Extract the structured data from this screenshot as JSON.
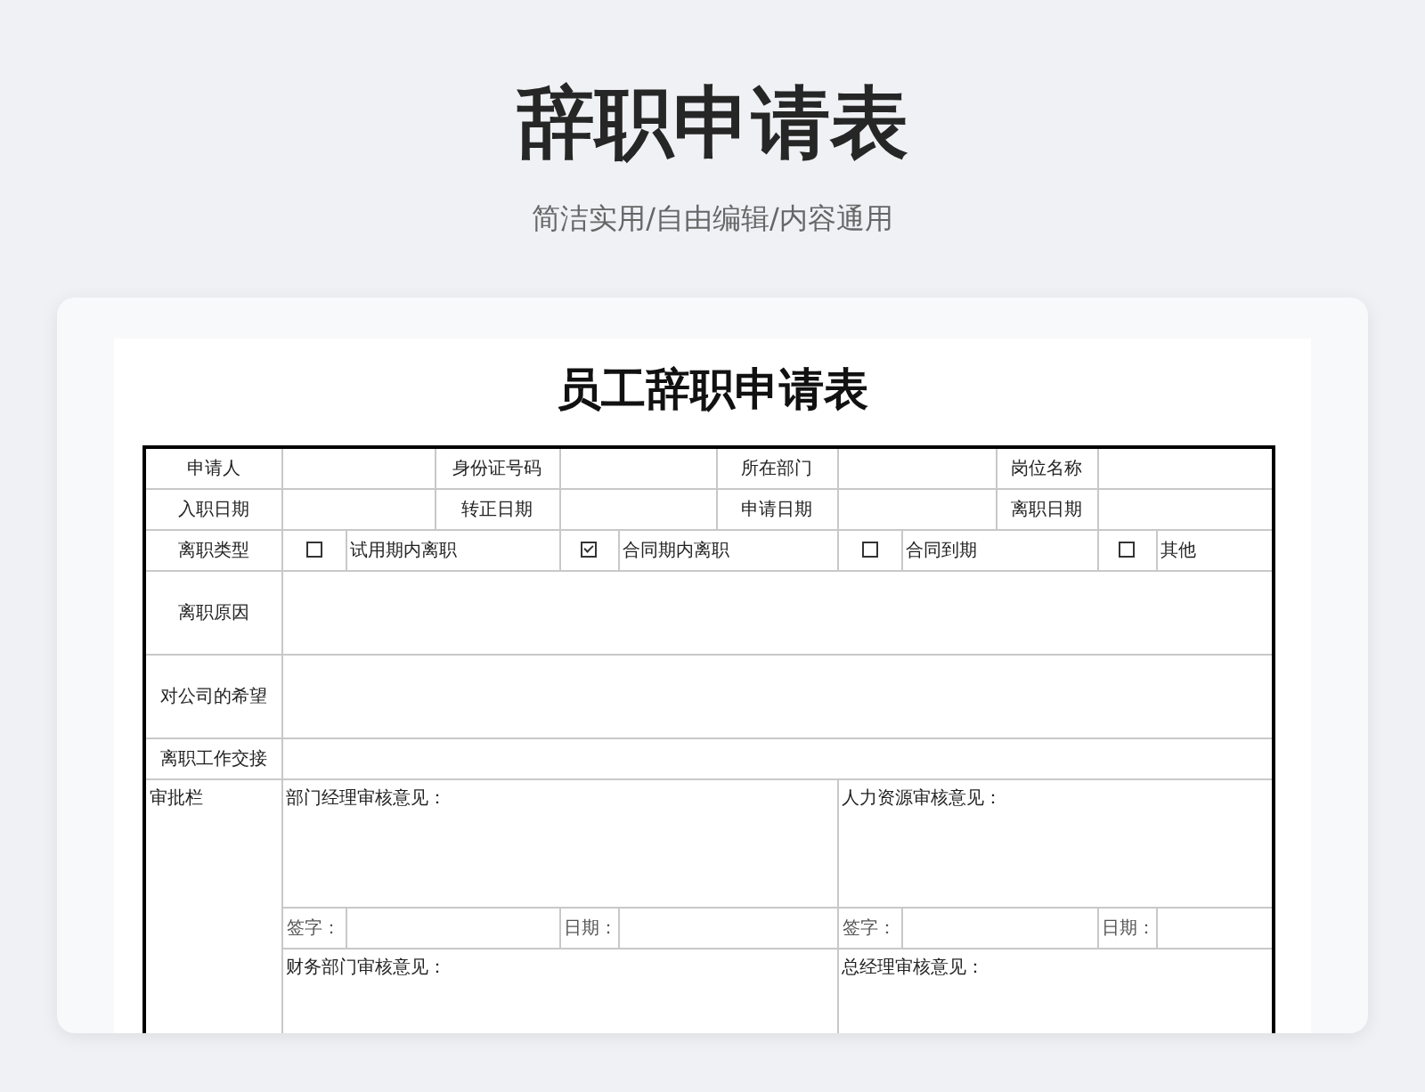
{
  "header": {
    "title": "辞职申请表",
    "subtitle": "简洁实用/自由编辑/内容通用"
  },
  "document": {
    "title": "员工辞职申请表",
    "info_rows": [
      {
        "labels": [
          "申请人",
          "身份证号码",
          "所在部门",
          "岗位名称"
        ]
      },
      {
        "labels": [
          "入职日期",
          "转正日期",
          "申请日期",
          "离职日期"
        ]
      }
    ],
    "leave_type": {
      "label": "离职类型",
      "options": [
        {
          "label": "试用期内离职",
          "checked": false
        },
        {
          "label": "合同期内离职",
          "checked": true
        },
        {
          "label": "合同到期",
          "checked": false
        },
        {
          "label": "其他",
          "checked": false
        }
      ]
    },
    "text_rows": [
      {
        "label": "离职原因",
        "kind": "tall"
      },
      {
        "label": "对公司的希望",
        "kind": "tall"
      },
      {
        "label": "离职工作交接",
        "kind": "short"
      }
    ],
    "approval": {
      "label": "审批栏",
      "sections": [
        {
          "title": "部门经理审核意见：",
          "signature_label": "签字：",
          "date_label": "日期："
        },
        {
          "title": "人力资源审核意见：",
          "signature_label": "签字：",
          "date_label": "日期："
        },
        {
          "title": "财务部门审核意见："
        },
        {
          "title": "总经理审核意见："
        }
      ]
    }
  }
}
